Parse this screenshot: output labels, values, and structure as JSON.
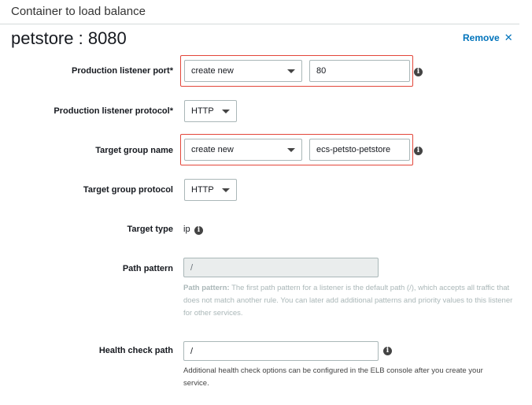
{
  "section": {
    "title": "Container to load balance"
  },
  "container": {
    "name": "petstore : 8080",
    "remove_label": "Remove",
    "remove_icon": "close-icon"
  },
  "fields": {
    "production_listener_port": {
      "label": "Production listener port*",
      "select_value": "create new",
      "input_value": "80"
    },
    "production_listener_protocol": {
      "label": "Production listener protocol*",
      "select_value": "HTTP"
    },
    "target_group_name": {
      "label": "Target group name",
      "select_value": "create new",
      "input_value": "ecs-petsto-petstore"
    },
    "target_group_protocol": {
      "label": "Target group protocol",
      "select_value": "HTTP"
    },
    "target_type": {
      "label": "Target type",
      "value": "ip"
    },
    "path_pattern": {
      "label": "Path pattern",
      "value": "/",
      "help_title": "Path pattern:",
      "help_text": "The first path pattern for a listener is the default path (/), which accepts all traffic that does not match another rule. You can later add additional patterns and priority values to this listener for other services."
    },
    "health_check_path": {
      "label": "Health check path",
      "value": "/",
      "help_text": "Additional health check options can be configured in the ELB console after you create your service."
    }
  },
  "colors": {
    "accent": "#0073bb",
    "highlight": "#e3463a"
  }
}
